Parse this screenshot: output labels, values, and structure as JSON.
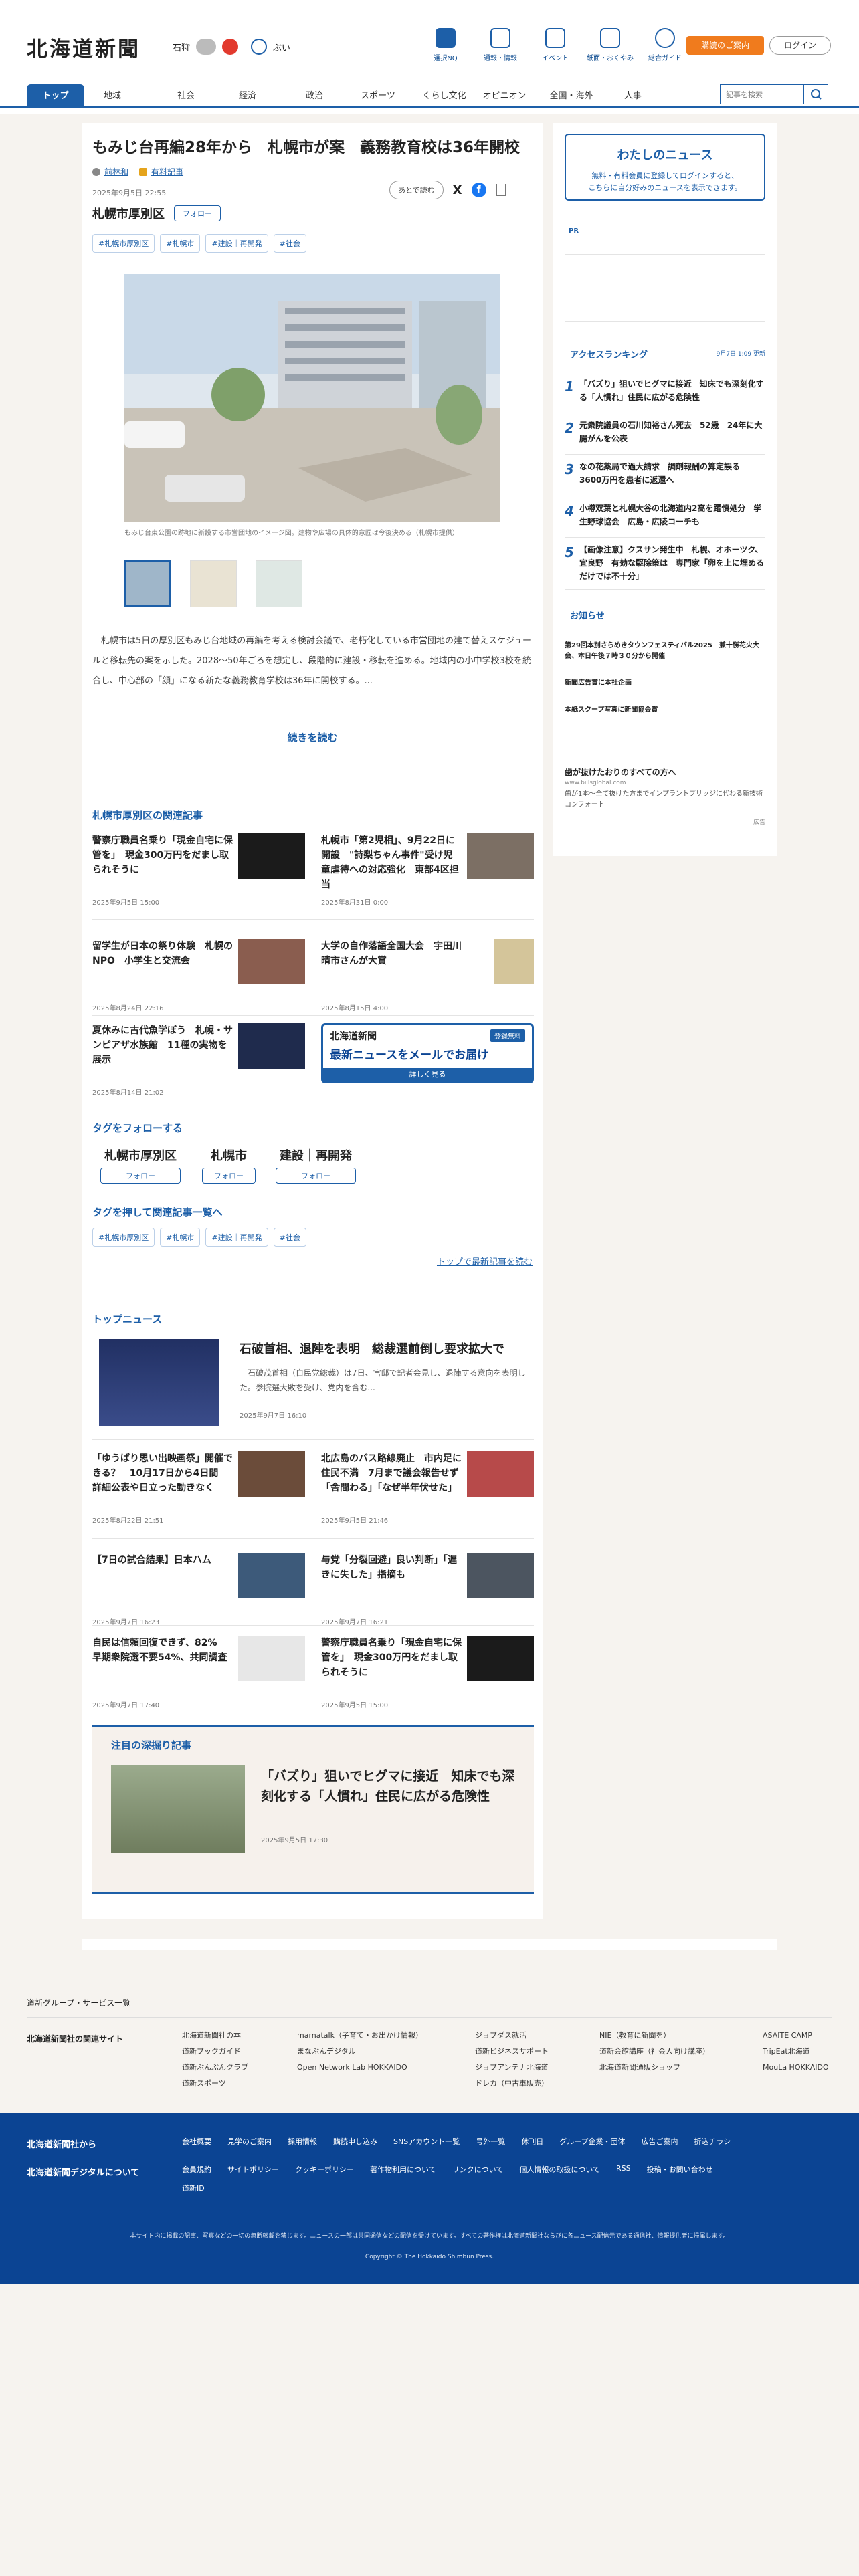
{
  "header": {
    "logo": "北海道新聞",
    "weather": {
      "city": "石狩",
      "status": "ぶい"
    },
    "nav": [
      {
        "label": "選択NQ",
        "icon": "bookmark-icon"
      },
      {
        "label": "通報・情報",
        "icon": "flag-icon"
      },
      {
        "label": "イベント",
        "icon": "calendar-icon"
      },
      {
        "label": "紙面・おくやみ",
        "icon": "newspaper-icon"
      },
      {
        "label": "総合ガイド",
        "icon": "help-icon"
      }
    ],
    "subscribe": "購読のご案内",
    "login": "ログイン"
  },
  "categories": [
    "トップ",
    "地域",
    "社会",
    "経済",
    "政治",
    "スポーツ",
    "くらし文化",
    "オピニオン",
    "全国・海外",
    "人事"
  ],
  "search": {
    "placeholder": "記事を検索"
  },
  "article": {
    "title": "もみじ台再編28年から　札幌市が案　義務教育校は36年開校",
    "author": "前林和",
    "paid": "有料記事",
    "date": "2025年9月5日 22:55",
    "area": "札幌市厚別区",
    "follow": "フォロー",
    "later": "あとで読む",
    "tags": [
      "#札幌市厚別区",
      "#札幌市",
      "#建設｜再開発",
      "#社会"
    ],
    "caption": "もみじ台東公園の跡地に新設する市営団地のイメージ図。建物や広場の具体的意匠は今後決める（札幌市提供）",
    "body": "　札幌市は5日の厚別区もみじ台地域の再編を考える検討会議で、老朽化している市営団地の建て替えスケジュールと移転先の案を示した。2028～50年ごろを想定し、段階的に建設・移転を進める。地域内の小中学校3校を統合し、中心部の「顔」になる新たな義務教育学校は36年に開校する。...",
    "more": "続きを読む"
  },
  "related": {
    "heading": "札幌市厚別区の関連記事",
    "items": [
      {
        "title": "警察庁職員名乗り「現金自宅に保管を」　現金300万円をだまし取られそうに",
        "date": "2025年9月5日 15:00"
      },
      {
        "title": "札幌市「第2児相」、9月22日に開設　\"詩梨ちゃん事件\"受け児童虐待への対応強化　東部4区担当",
        "date": "2025年8月31日 0:00"
      },
      {
        "title": "留学生が日本の祭り体験　札幌のNPO　小学生と交流会",
        "date": "2025年8月24日 22:16"
      },
      {
        "title": "大学の自作落語全国大会　宇田川晴市さんが大賞",
        "date": "2025年8月15日 4:00"
      },
      {
        "title": "夏休みに古代魚学ぼう　札幌・サンピアザ水族館　11種の実物を展示",
        "date": "2025年8月14日 21:02"
      }
    ],
    "banner": {
      "logo": "北海道新聞",
      "badge": "登録無料",
      "title": "最新ニュースをメールでお届け",
      "btn": "詳しく見る"
    }
  },
  "follow_tags": {
    "heading": "タグをフォローする",
    "items": [
      "札幌市厚別区",
      "札幌市",
      "建設｜再開発"
    ],
    "btn": "フォロー"
  },
  "push_tags": {
    "heading": "タグを押して関連記事一覧へ",
    "items": [
      "#札幌市厚別区",
      "#札幌市",
      "#建設｜再開発",
      "#社会"
    ],
    "back": "トップで最新記事を読む"
  },
  "top_news": {
    "heading": "トップニュース",
    "lead": {
      "title": "石破首相、退陣を表明　総裁選前倒し要求拡大で",
      "text": "　石破茂首相（自民党総裁）は7日、官邸で記者会見し、退陣する意向を表明した。参院選大敗を受け、党内を含む...",
      "date": "2025年9月7日 16:10"
    },
    "items": [
      {
        "title": "「ゆうばり思い出映画祭」開催できる？　10月17日から4日間　詳細公表や日立った動きなく",
        "date": "2025年8月22日 21:51"
      },
      {
        "title": "北広島のバス路線廃止　市内足に住民不満　7月まで議会報告せず　「舎間わる」「なぜ半年伏せた」",
        "date": "2025年9月5日 21:46"
      },
      {
        "title": "【7日の試合結果】日本ハム",
        "date": "2025年9月7日 16:23"
      },
      {
        "title": "与党「分裂回避」良い判断」「遅きに失した」指摘も",
        "date": "2025年9月7日 16:21"
      },
      {
        "title": "自民は信頼回復できず、82%　早期衆院選不要54%、共同調査",
        "date": "2025年9月7日 17:40"
      },
      {
        "title": "警察庁職員名乗り「現金自宅に保管を」　現金300万円をだまし取られそうに",
        "date": "2025年9月5日 15:00"
      }
    ],
    "featured": {
      "heading": "注目の深掘り記事",
      "title": "「バズり」狙いでヒグマに接近　知床でも深刻化する「人慣れ」住民に広がる危険性",
      "date": "2025年9月5日 17:30"
    }
  },
  "side": {
    "mynews": {
      "title": "わたしのニュース",
      "text1": "無料・有料会員に登録して",
      "link": "ログイン",
      "text2": "すると、",
      "text3": "こちらに自分好みのニュースを表示できます。"
    },
    "pr": "PR",
    "ranking": {
      "heading": "アクセスランキング",
      "updated": "9月7日 1:09 更新",
      "items": [
        "「バズり」狙いでヒグマに接近　知床でも深刻化する「人慣れ」住民に広がる危険性",
        "元衆院議員の石川知裕さん死去　52歳　24年に大腸がんを公表",
        "なの花薬局で過大請求　調剤報酬の算定誤る　3600万円を患者に返還へ",
        "小樽双葉と札幌大谷の北海道内2高を躍慎処分　学生野球協会　広島・広陵コーチも",
        "【画像注意】クスサン発生中　札幌、オホーツク、宜良野　有効な駆除策は　専門家「卵を上に埋めるだけでは不十分」"
      ]
    },
    "notice": {
      "heading": "お知らせ",
      "items": [
        "第29回本別さらめきタウンフェスティバル2025　兼十勝花火大会、本日午後７時３０分から開催",
        "新聞広告賞に本社企画",
        "本紙スクープ写真に新聞協会賞"
      ]
    },
    "ad": {
      "title": "歯が抜けたおりのすべての方へ",
      "url": "www.billsglobal.com",
      "text": "歯が1本〜全て抜けた方までインプラントブリッジに代わる新技術コンフォート",
      "label": "広告"
    }
  },
  "footer": {
    "group": "道新グループ・サービス一覧",
    "sites_title": "北海道新聞社の関連サイト",
    "sites": [
      [
        "北海道新聞社の本",
        "道新ブックガイド",
        "道新ぶんぶんクラブ",
        "道新スポーツ"
      ],
      [
        "marnatalk（子育て・お出かけ情報）",
        "まなぶんデジタル",
        "Open Network Lab HOKKAIDO"
      ],
      [
        "ジョブダス就活",
        "道新ビジネスサポート",
        "ジョブアンテナ北海道",
        "ドレカ（中古車販売）"
      ],
      [
        "NIE（教育に新聞を）",
        "道新会館講座（社会人向け講座）",
        "北海道新聞通販ショップ"
      ],
      [
        "ASAITE CAMP",
        "TripEat北海道",
        "MouLa HOKKAIDO"
      ]
    ],
    "corp_title": "北海道新聞社から",
    "corp_links": [
      "会社概要",
      "見学のご案内",
      "採用情報",
      "購読申し込み",
      "SNSアカウント一覧",
      "号外一覧",
      "休刊日",
      "グループ企業・団体",
      "広告ご案内",
      "折込チラシ"
    ],
    "digital_title": "北海道新聞デジタルについて",
    "digital_links": [
      "会員規約",
      "サイトポリシー",
      "クッキーポリシー",
      "著作物利用について",
      "リンクについて",
      "個人情報の取扱について",
      "RSS",
      "投稿・お問い合わせ",
      "道新ID"
    ],
    "notice": "本サイト内に掲載の記事、写真などの一切の無断転載を禁じます。ニュースの一部は共同通信などの配信を受けています。すべての著作権は北海道新聞社ならびに各ニュース配信元である通信社、情報提供者に帰属します。",
    "copyright": "Copyright © The Hokkaido Shimbun Press."
  },
  "colors": {
    "brand": "#1d5fa8",
    "accent": "#f07b1d",
    "footer": "#0b4493"
  }
}
